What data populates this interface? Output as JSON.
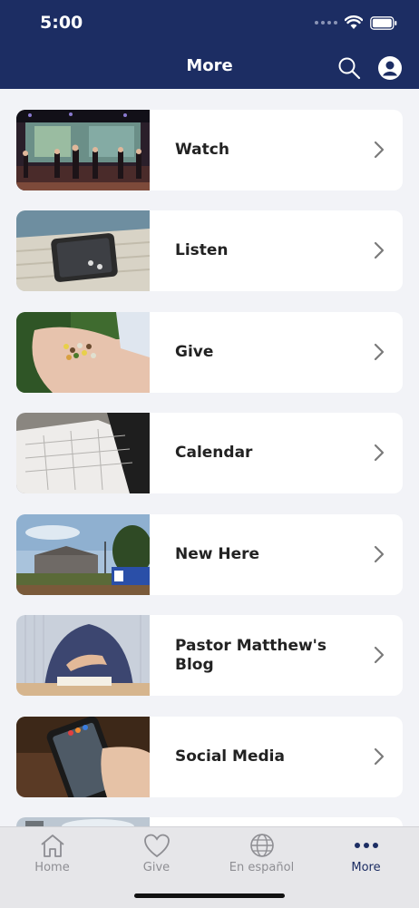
{
  "status_bar": {
    "time": "5:00"
  },
  "header": {
    "title": "More"
  },
  "menu": [
    {
      "label": "Watch",
      "image": "worship-band-stage"
    },
    {
      "label": "Listen",
      "image": "phone-on-hammock"
    },
    {
      "label": "Give",
      "image": "hands-holding-seeds"
    },
    {
      "label": "Calendar",
      "image": "open-planner-book"
    },
    {
      "label": "New Here",
      "image": "church-building"
    },
    {
      "label": "Pastor Matthew's Blog",
      "image": "man-with-bible"
    },
    {
      "label": "Social Media",
      "image": "hand-holding-phone"
    }
  ],
  "tabbar": {
    "tabs": [
      {
        "label": "Home",
        "icon": "house-icon"
      },
      {
        "label": "Give",
        "icon": "heart-icon"
      },
      {
        "label": "En español",
        "icon": "globe-icon"
      },
      {
        "label": "More",
        "icon": "more-dots-icon",
        "active": true
      }
    ]
  },
  "colors": {
    "header_bg": "#1c2d63",
    "active_tab": "#1c2d63",
    "inactive_tab": "#8e8e93"
  }
}
